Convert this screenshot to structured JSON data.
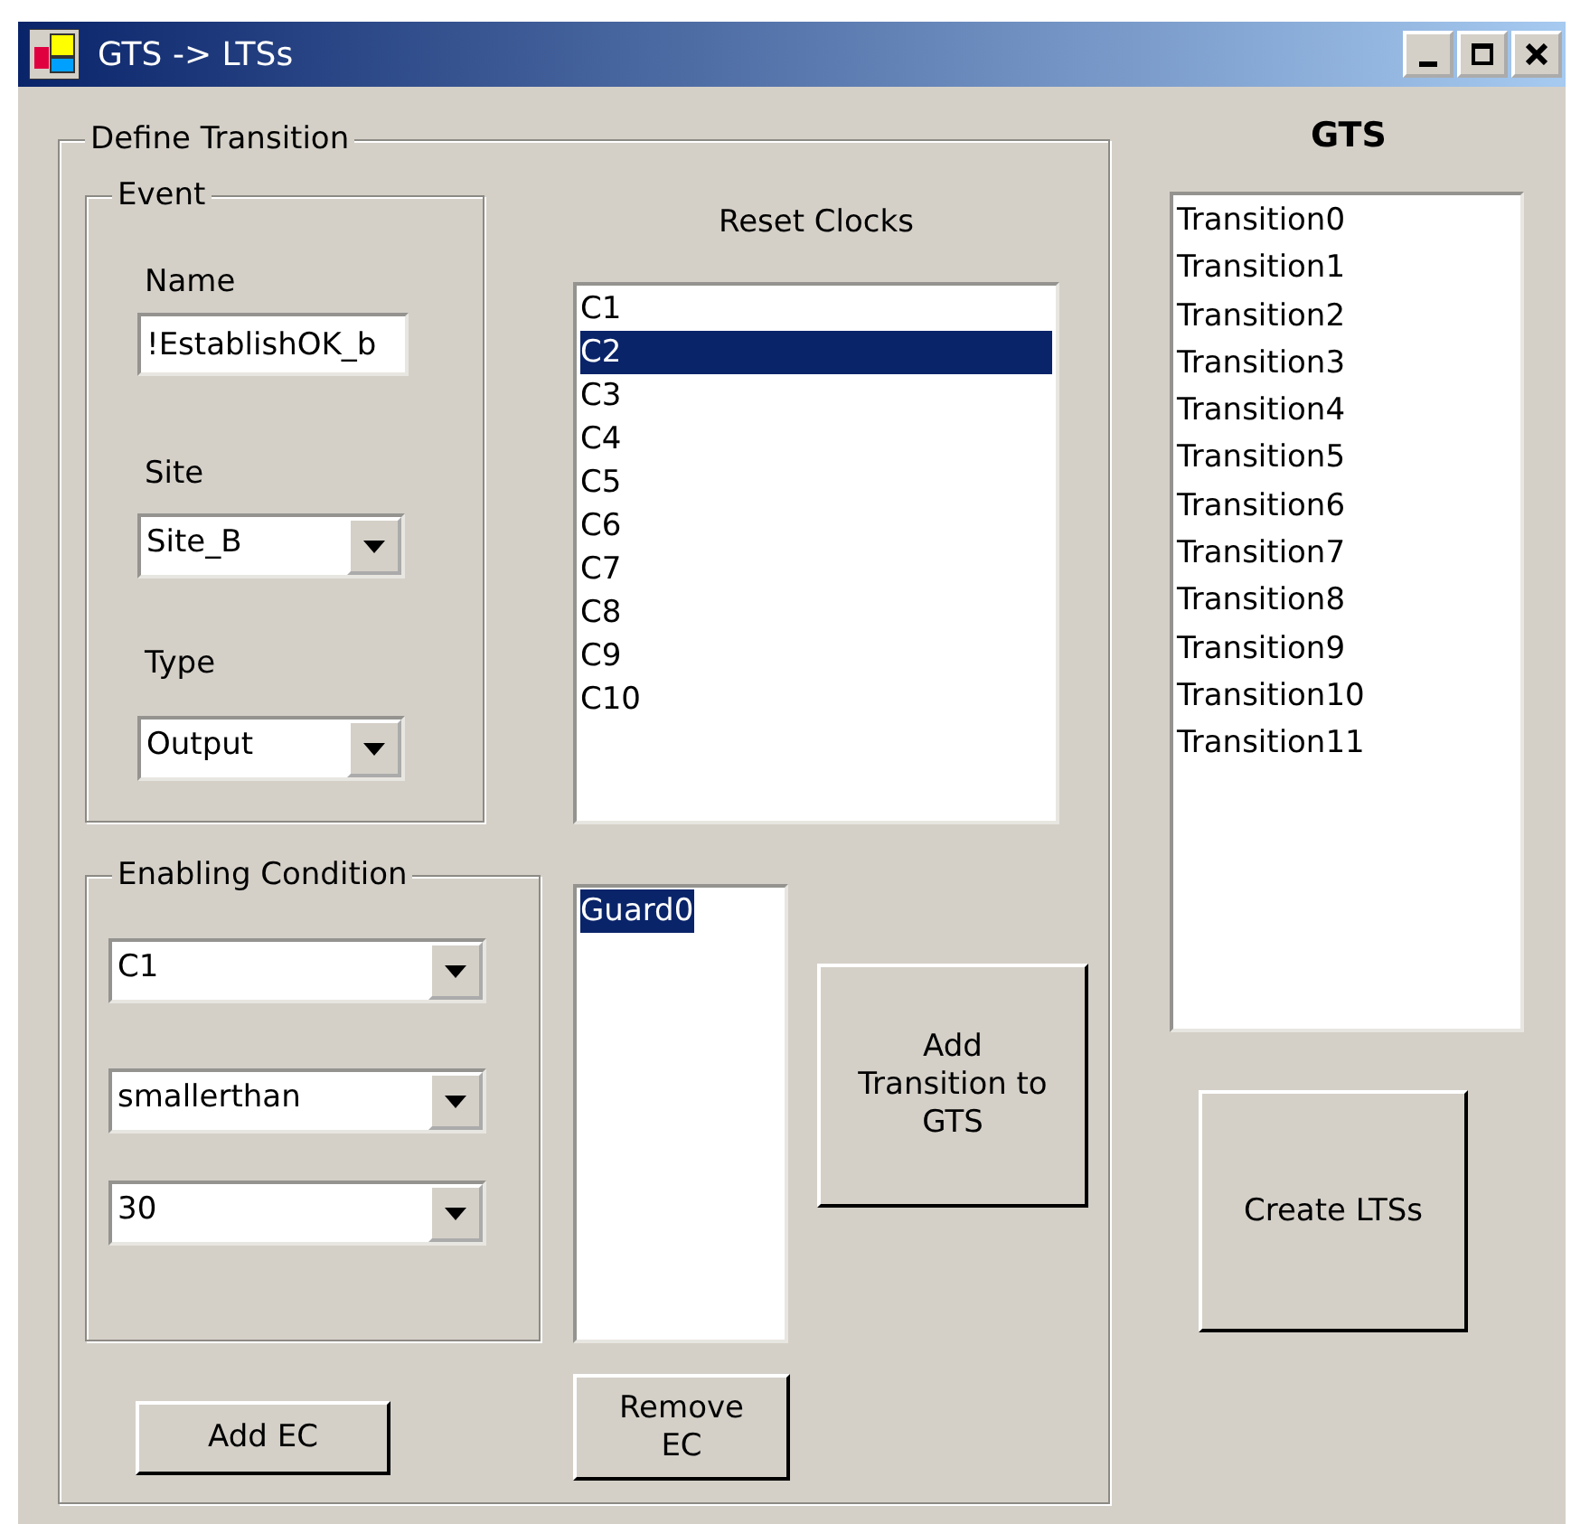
{
  "window": {
    "title": "GTS -> LTSs"
  },
  "define_transition": {
    "title": "Define Transition",
    "event": {
      "title": "Event",
      "name_label": "Name",
      "name_value": "!EstablishOK_b",
      "site_label": "Site",
      "site_value": "Site_B",
      "type_label": "Type",
      "type_value": "Output"
    },
    "reset_clocks": {
      "label": "Reset Clocks",
      "items": [
        {
          "text": "C1",
          "selected": false
        },
        {
          "text": "C2",
          "selected": true
        },
        {
          "text": "C3",
          "selected": false
        },
        {
          "text": "C4",
          "selected": false
        },
        {
          "text": "C5",
          "selected": false
        },
        {
          "text": "C6",
          "selected": false
        },
        {
          "text": "C7",
          "selected": false
        },
        {
          "text": "C8",
          "selected": false
        },
        {
          "text": "C9",
          "selected": false
        },
        {
          "text": "C10",
          "selected": false
        }
      ]
    },
    "enabling_condition": {
      "title": "Enabling Condition",
      "fields": [
        "C1",
        "smallerthan",
        "30"
      ]
    },
    "guards": [
      {
        "text": "Guard0",
        "selected": true
      }
    ],
    "add_transition_button": "Add Transition to GTS",
    "add_ec_button": "Add EC",
    "remove_ec_button": "Remove EC"
  },
  "gts": {
    "title": "GTS",
    "items": [
      {
        "text": "Transition0",
        "selected": false
      },
      {
        "text": "Transition1",
        "selected": false
      },
      {
        "text": "Transition2",
        "selected": false
      },
      {
        "text": "Transition3",
        "selected": false
      },
      {
        "text": "Transition4",
        "selected": false
      },
      {
        "text": "Transition5",
        "selected": false
      },
      {
        "text": "Transition6",
        "selected": false
      },
      {
        "text": "Transition7",
        "selected": false
      },
      {
        "text": "Transition8",
        "selected": false
      },
      {
        "text": "Transition9",
        "selected": false
      },
      {
        "text": "Transition10",
        "selected": false
      },
      {
        "text": "Transition11",
        "selected": false
      }
    ],
    "create_button": "Create LTSs"
  }
}
